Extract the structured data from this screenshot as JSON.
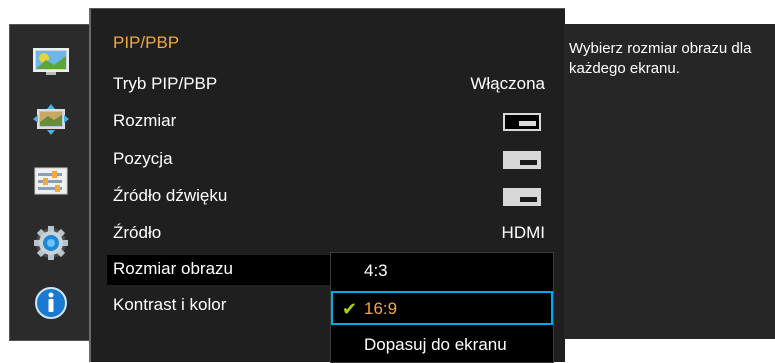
{
  "menu": {
    "title": "PIP/PBP",
    "rows": [
      {
        "label": "Tryb PIP/PBP",
        "value": "Włączona"
      },
      {
        "label": "Rozmiar",
        "value": ""
      },
      {
        "label": "Pozycja",
        "value": ""
      },
      {
        "label": "Źródło dźwięku",
        "value": ""
      },
      {
        "label": "Źródło",
        "value": "HDMI"
      },
      {
        "label": "Rozmiar obrazu",
        "value": ""
      },
      {
        "label": "Kontrast i kolor",
        "value": ""
      }
    ]
  },
  "dropdown": {
    "options": [
      "4:3",
      "16:9",
      "Dopasuj do ekranu"
    ],
    "selected": "16:9"
  },
  "info": {
    "text": "Wybierz rozmiar obrazu dla każdego ekranu."
  },
  "sidebar": {
    "icons": [
      "picture-icon",
      "screen-size-icon",
      "settings-list-icon",
      "gear-icon",
      "info-icon"
    ]
  },
  "colors": {
    "title": "#f2a93b",
    "highlight_border": "#00a9e8",
    "check": "#a6d10f"
  }
}
